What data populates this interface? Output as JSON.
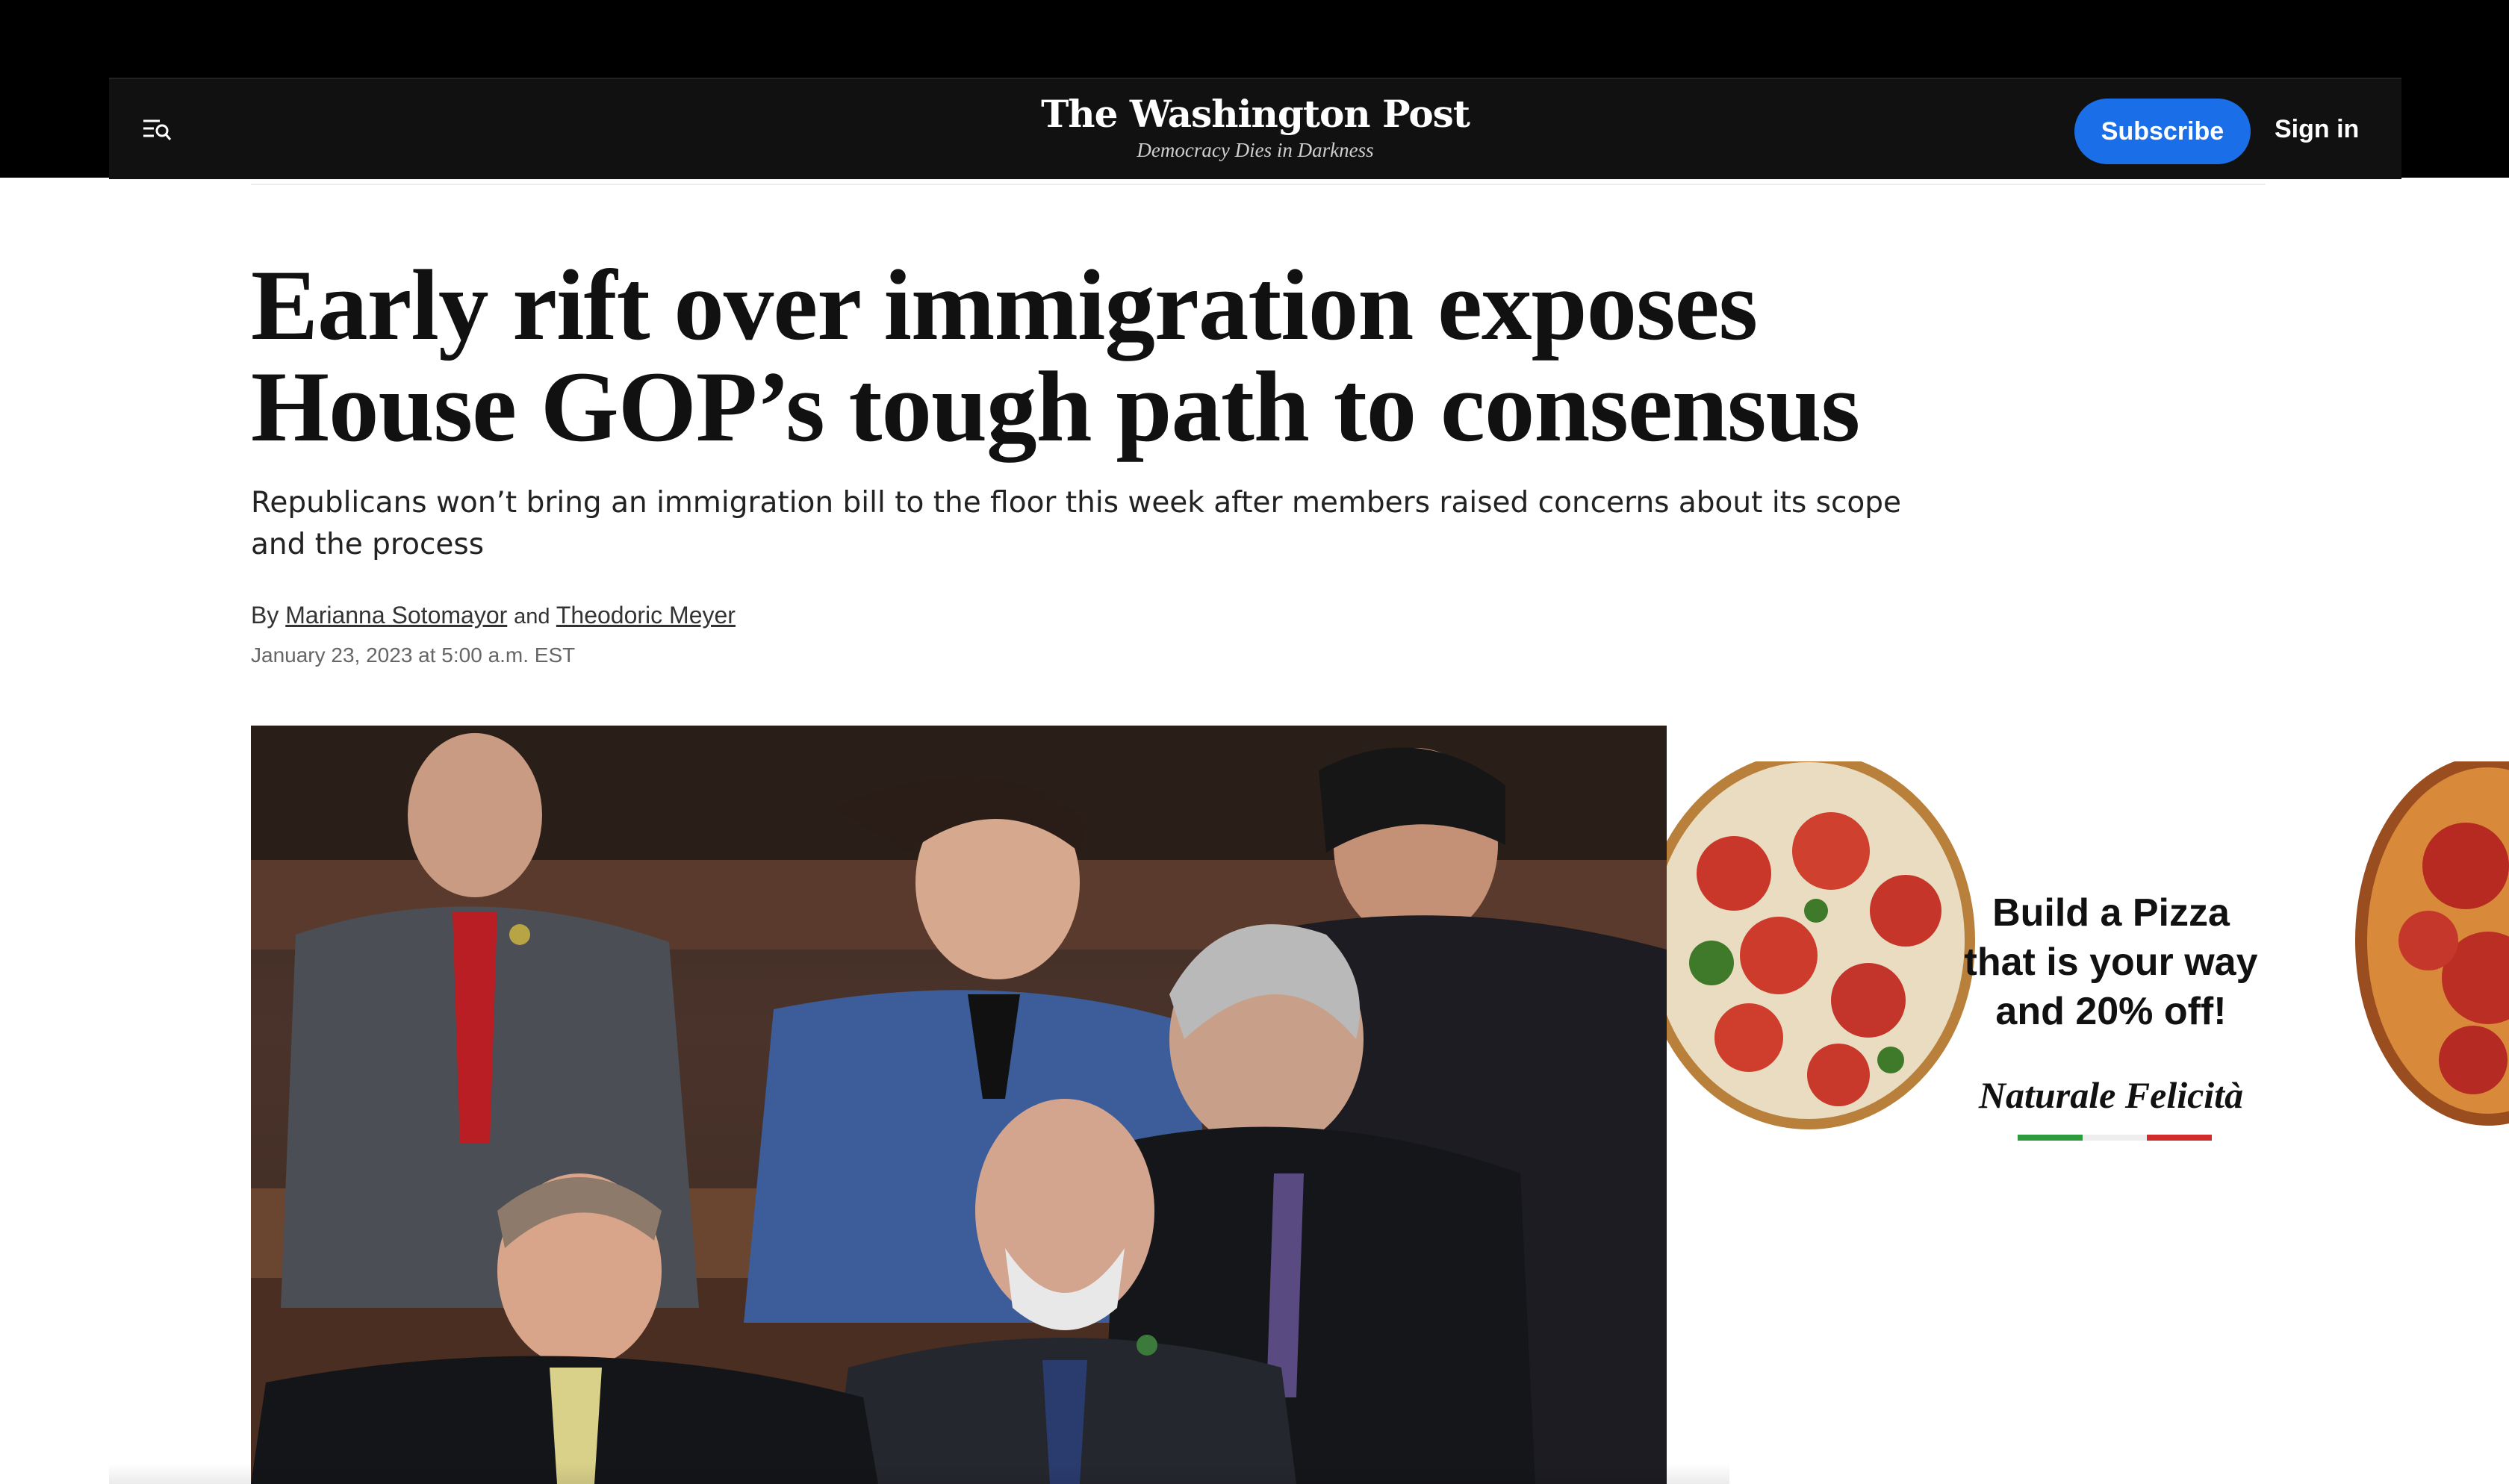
{
  "header": {
    "logo_title": "The Washington Post",
    "logo_tagline": "Democracy Dies in Darkness",
    "subscribe_label": "Subscribe",
    "signin_label": "Sign in",
    "menu_icon": "menu-search-icon"
  },
  "article": {
    "headline": "Early rift over immigration exposes House GOP’s tough path to consensus",
    "subheadline": "Republicans won’t bring an immigration bill to the floor this week after members raised concerns about its scope and the process",
    "byline_prefix": "By",
    "author_1": "Marianna Sotomayor",
    "byline_and": "and",
    "author_2": "Theodoric Meyer",
    "date": "January 23, 2023 at 5:00 a.m. EST"
  },
  "ad": {
    "headline": "Build a Pizza that is your way and 20% off!",
    "brand": "Naturale Felicità"
  },
  "colors": {
    "header_bg": "#111111",
    "subscribe_bg": "#1a6fe8",
    "page_bg": "#ffffff"
  }
}
